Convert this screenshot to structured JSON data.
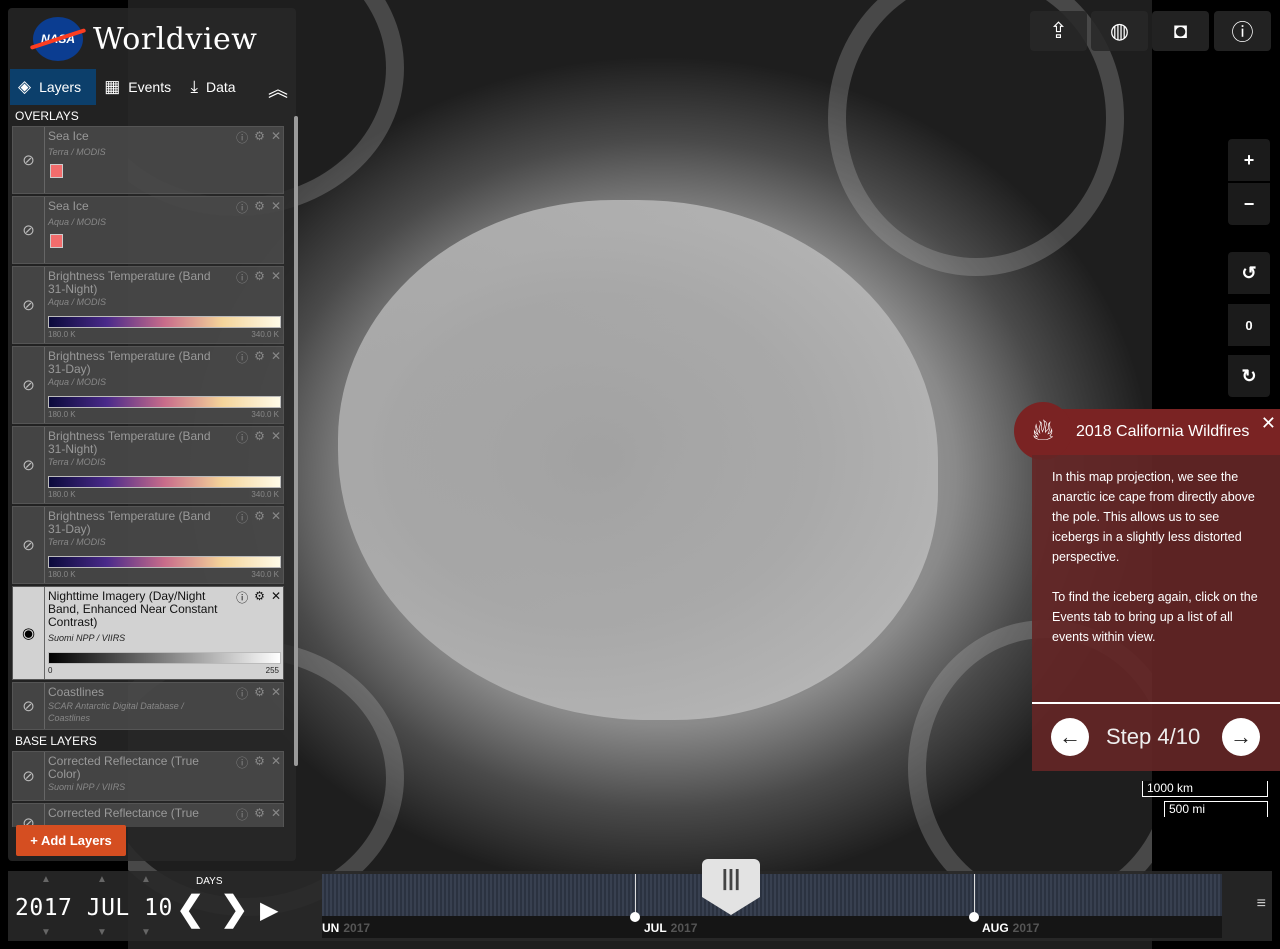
{
  "app": {
    "title": "Worldview",
    "logo_text": "NASA"
  },
  "tabs": [
    {
      "label": "Layers",
      "icon": "layers-icon"
    },
    {
      "label": "Events",
      "icon": "calendar-icon"
    },
    {
      "label": "Data",
      "icon": "download-icon"
    }
  ],
  "sections": {
    "overlays": "OVERLAYS",
    "base": "BASE LAYERS"
  },
  "layers": [
    {
      "name": "Sea Ice",
      "source": "Terra / MODIS",
      "swatch": "#f26c6c"
    },
    {
      "name": "Sea Ice",
      "source": "Aqua / MODIS",
      "swatch": "#f26c6c"
    },
    {
      "name": "Brightness Temperature (Band 31-Night)",
      "source": "Aqua / MODIS",
      "min": "180.0 K",
      "max": "340.0 K"
    },
    {
      "name": "Brightness Temperature (Band 31-Day)",
      "source": "Aqua / MODIS",
      "min": "180.0 K",
      "max": "340.0 K"
    },
    {
      "name": "Brightness Temperature (Band 31-Night)",
      "source": "Terra / MODIS",
      "min": "180.0 K",
      "max": "340.0 K"
    },
    {
      "name": "Brightness Temperature (Band 31-Day)",
      "source": "Terra / MODIS",
      "min": "180.0 K",
      "max": "340.0 K"
    },
    {
      "name": "Nighttime Imagery (Day/Night Band, Enhanced Near Constant Contrast)",
      "source": "Suomi NPP / VIIRS",
      "min": "0",
      "max": "255"
    },
    {
      "name": "Coastlines",
      "source": "SCAR Antarctic Digital Database / Coastlines"
    }
  ],
  "base_layers": [
    {
      "name": "Corrected Reflectance (True Color)",
      "source": "Suomi NPP / VIIRS"
    },
    {
      "name": "Corrected Reflectance (True",
      "source": ""
    }
  ],
  "add_layers_label": "+ Add Layers",
  "zoom": {
    "plus": "+",
    "minus": "−"
  },
  "rotation": {
    "value": "0"
  },
  "tour": {
    "title": "2018 California Wildfires",
    "paragraph1": "In this map projection, we see the anarctic ice cape from directly above the pole. This allows us to see icebergs in a slightly less distorted perspective.",
    "paragraph2": "To find the iceberg again, click on the Events tab to bring up a list of all events within view.",
    "step": "Step 4/10"
  },
  "scale": {
    "km": "1000 km",
    "mi": "500 mi"
  },
  "timeline": {
    "date": "2017 JUL 10",
    "interval": "DAYS",
    "months": [
      {
        "label": "UN",
        "year": "2017"
      },
      {
        "label": "JUL",
        "year": "2017"
      },
      {
        "label": "AUG",
        "year": "2017"
      }
    ]
  },
  "colors": {
    "accent": "#d54e21",
    "tab_active": "#0c3f6b",
    "tour": "#7a2323"
  }
}
